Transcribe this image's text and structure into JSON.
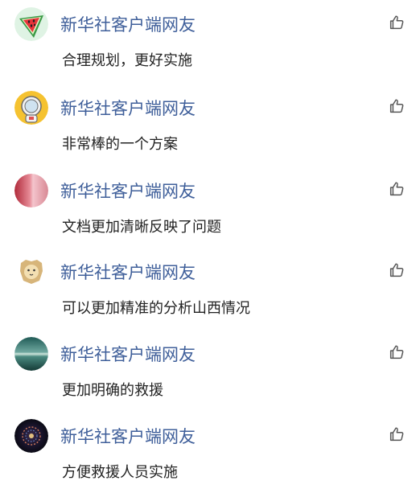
{
  "comments": [
    {
      "avatar": "watermelon-avatar-icon",
      "user": "新华社客户端网友",
      "text": "合理规划，更好实施"
    },
    {
      "avatar": "astronaut-avatar-icon",
      "user": "新华社客户端网友",
      "text": "非常棒的一个方案"
    },
    {
      "avatar": "pink-sphere-avatar-icon",
      "user": "新华社客户端网友",
      "text": "文档更加清晰反映了问题"
    },
    {
      "avatar": "lion-avatar-icon",
      "user": "新华社客户端网友",
      "text": "可以更加精准的分析山西情况"
    },
    {
      "avatar": "seascape-avatar-icon",
      "user": "新华社客户端网友",
      "text": "更加明确的救援"
    },
    {
      "avatar": "galaxy-avatar-icon",
      "user": "新华社客户端网友",
      "text": "方便救援人员实施"
    }
  ],
  "like_icon": "thumbs-up-icon"
}
